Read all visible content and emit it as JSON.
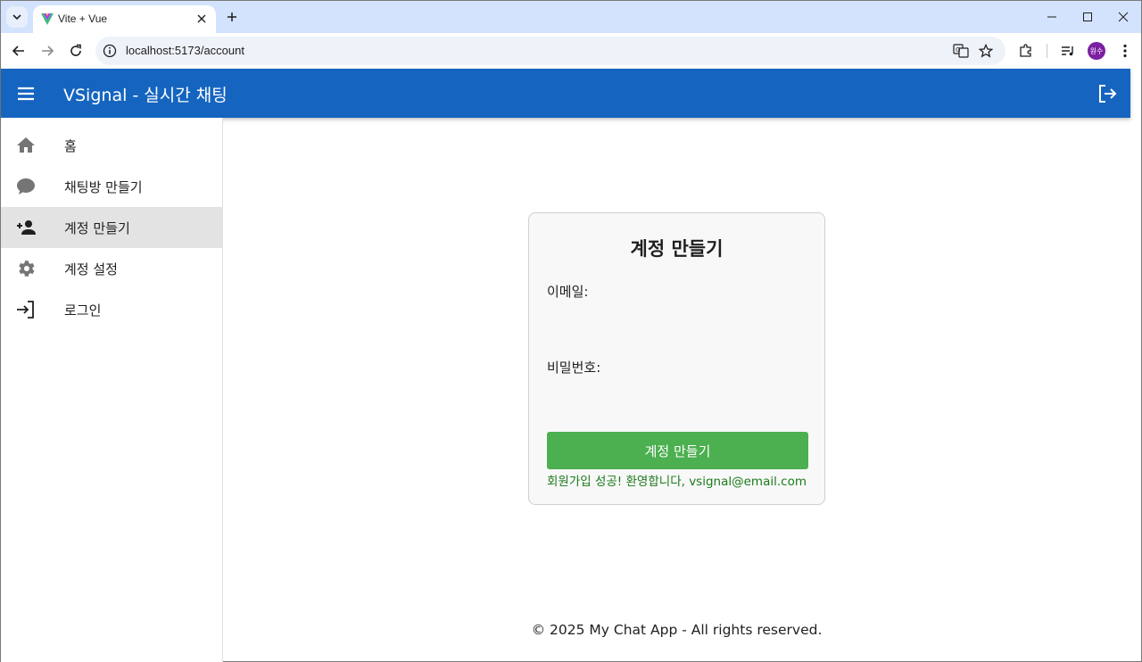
{
  "browser": {
    "tab_title": "Vite + Vue",
    "url": "localhost:5173/account",
    "profile_initials": "원수"
  },
  "app": {
    "title": "VSignal - 실시간 채팅",
    "primary_color": "#1565c0"
  },
  "sidebar": {
    "items": [
      {
        "label": "홈",
        "icon": "home-icon"
      },
      {
        "label": "채팅방 만들기",
        "icon": "chat-bubble-icon"
      },
      {
        "label": "계정 만들기",
        "icon": "person-add-icon",
        "active": true
      },
      {
        "label": "계정 설정",
        "icon": "gear-icon"
      },
      {
        "label": "로그인",
        "icon": "login-icon"
      }
    ]
  },
  "form": {
    "title": "계정 만들기",
    "email_label": "이메일:",
    "email_value": "",
    "password_label": "비밀번호:",
    "password_value": "",
    "submit_label": "계정 만들기",
    "submit_color": "#4caf50",
    "success_message": "회원가입 성공! 환영합니다, vsignal@email.com",
    "success_color": "#1b7a1b"
  },
  "footer": {
    "text": "© 2025 My Chat App - All rights reserved."
  }
}
